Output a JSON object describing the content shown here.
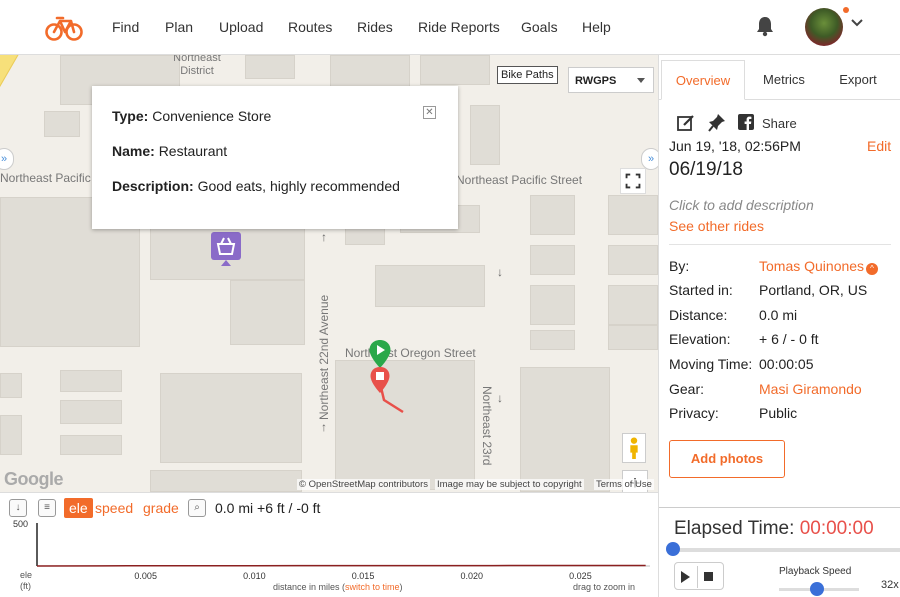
{
  "nav": {
    "items": [
      "Find",
      "Plan",
      "Upload",
      "Routes",
      "Rides",
      "Ride Reports",
      "Goals",
      "Help"
    ]
  },
  "map": {
    "bike_paths_label": "Bike Paths",
    "map_type": "RWGPS",
    "streets": {
      "ne_district": "Northeast District",
      "ne_pacific_left": "Northeast Pacific",
      "ne_pacific_right": "Northeast Pacific Street",
      "ne_22nd": "Northeast 22nd Avenue",
      "ne_oregon": "Northeast Oregon Street",
      "ne_23rd": "Northeast 23rd"
    },
    "zoom_in": "+",
    "zoom_out": "−",
    "google_logo": "Google",
    "attribution": "© OpenStreetMap contributors",
    "imagery_note": "Image may be subject to copyright",
    "terms": "Terms of Use"
  },
  "popup": {
    "type_label": "Type:",
    "type_value": "Convenience Store",
    "name_label": "Name:",
    "name_value": "Restaurant",
    "desc_label": "Description:",
    "desc_value": "Good eats, highly recommended"
  },
  "elevation": {
    "tabs": {
      "ele": "ele",
      "speed": "speed",
      "grade": "grade"
    },
    "summary": "0.0 mi +6 ft / -0 ft",
    "y_label_line1": "ele",
    "y_label_line2": "(ft)",
    "x_axis_label": "distance in miles (",
    "switch_link": "switch to time",
    "x_axis_label_end": ")",
    "zoom_hint": "drag to zoom in"
  },
  "chart_data": {
    "type": "line",
    "xlabel": "distance in miles",
    "ylabel": "ele (ft)",
    "ylim": [
      0,
      500
    ],
    "y_ticks": [
      "500"
    ],
    "x_ticks": [
      "0.005",
      "0.010",
      "0.015",
      "0.020",
      "0.025"
    ],
    "series": [
      {
        "x": [
          0.0,
          0.003,
          0.006,
          0.009,
          0.012,
          0.015,
          0.018,
          0.021,
          0.024,
          0.028
        ],
        "values": [
          0,
          2,
          3,
          3,
          4,
          4,
          5,
          5,
          6,
          6
        ]
      }
    ]
  },
  "panel": {
    "tabs": [
      "Overview",
      "Metrics",
      "Export"
    ],
    "share_label": "Share",
    "date_time": "Jun 19, '18, 02:56PM",
    "edit_label": "Edit",
    "title": "06/19/18",
    "description_placeholder": "Click to add description",
    "see_other_rides": "See other rides",
    "stats": [
      {
        "label": "By:",
        "value": "Tomas Quinones",
        "link": true
      },
      {
        "label": "Started in:",
        "value": "Portland, OR, US",
        "link": false
      },
      {
        "label": "Distance:",
        "value": "0.0 mi",
        "link": false
      },
      {
        "label": "Elevation:",
        "value": "+ 6 / - 0 ft",
        "link": false
      },
      {
        "label": "Moving Time:",
        "value": "00:00:05",
        "link": false
      },
      {
        "label": "Gear:",
        "value": "Masi Giramondo",
        "link": true
      },
      {
        "label": "Privacy:",
        "value": "Public",
        "link": false
      }
    ],
    "add_photos": "Add photos",
    "playback": {
      "elapsed_label": "Elapsed Time:",
      "elapsed_value": "00:00:00",
      "speed_label": "Playback Speed",
      "speed_value": "32x"
    }
  },
  "colors": {
    "accent": "#f26b2a",
    "route": "#e8504a",
    "start_marker": "#2aa84a",
    "poi_marker": "#8a6bc8"
  }
}
